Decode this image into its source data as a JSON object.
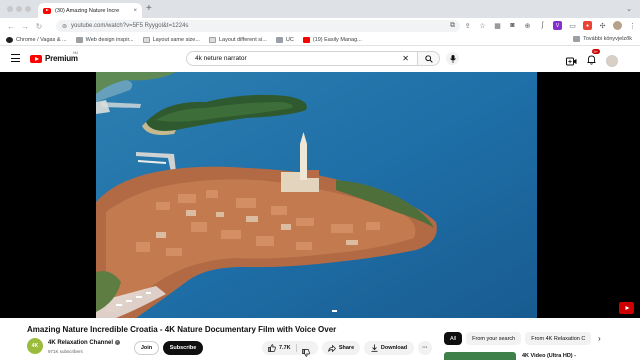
{
  "browser": {
    "tab_title": "(30) Amazing Nature Incre",
    "tab_close": "×",
    "new_tab": "+",
    "url": "youtube.com/watch?v=5F5 Ryygol&t=1224s",
    "bookmarks": [
      {
        "label": "Chrome / Vagas & ...",
        "icon": "chrome-icon"
      },
      {
        "label": "Web design inspir...",
        "icon": "folder-icon"
      },
      {
        "label": "Layout same size...",
        "icon": "page-icon"
      },
      {
        "label": "Layout different si...",
        "icon": "page-icon"
      },
      {
        "label": "UC",
        "icon": "folder-icon"
      },
      {
        "label": "(19) Easily Manag...",
        "icon": "youtube-icon"
      }
    ],
    "other_bookmarks": "További könyvjelzők"
  },
  "youtube": {
    "logo_text": "Premium",
    "region": "HU",
    "search_value": "4k neture narrator",
    "notification_count": "9+"
  },
  "video": {
    "title": "Amazing Nature Incredible Croatia - 4K Nature Documentary Film with Voice Over",
    "channel_name": "4K Relaxation Channel",
    "channel_avatar_text": "4K",
    "subscribers": "971K subscribers",
    "join_label": "Join",
    "subscribe_label": "Subscribe",
    "likes": "7.7K",
    "share_label": "Share",
    "download_label": "Download",
    "more_label": "···"
  },
  "recommendations": {
    "chips": [
      "All",
      "From your search",
      "From 4K Relaxation C"
    ],
    "first_title": "4K Video (Ultra HD) -"
  },
  "colors": {
    "youtube_red": "#ff0000",
    "subscribe_bg": "#0f0f0f",
    "sea": "#1f6fa8"
  }
}
